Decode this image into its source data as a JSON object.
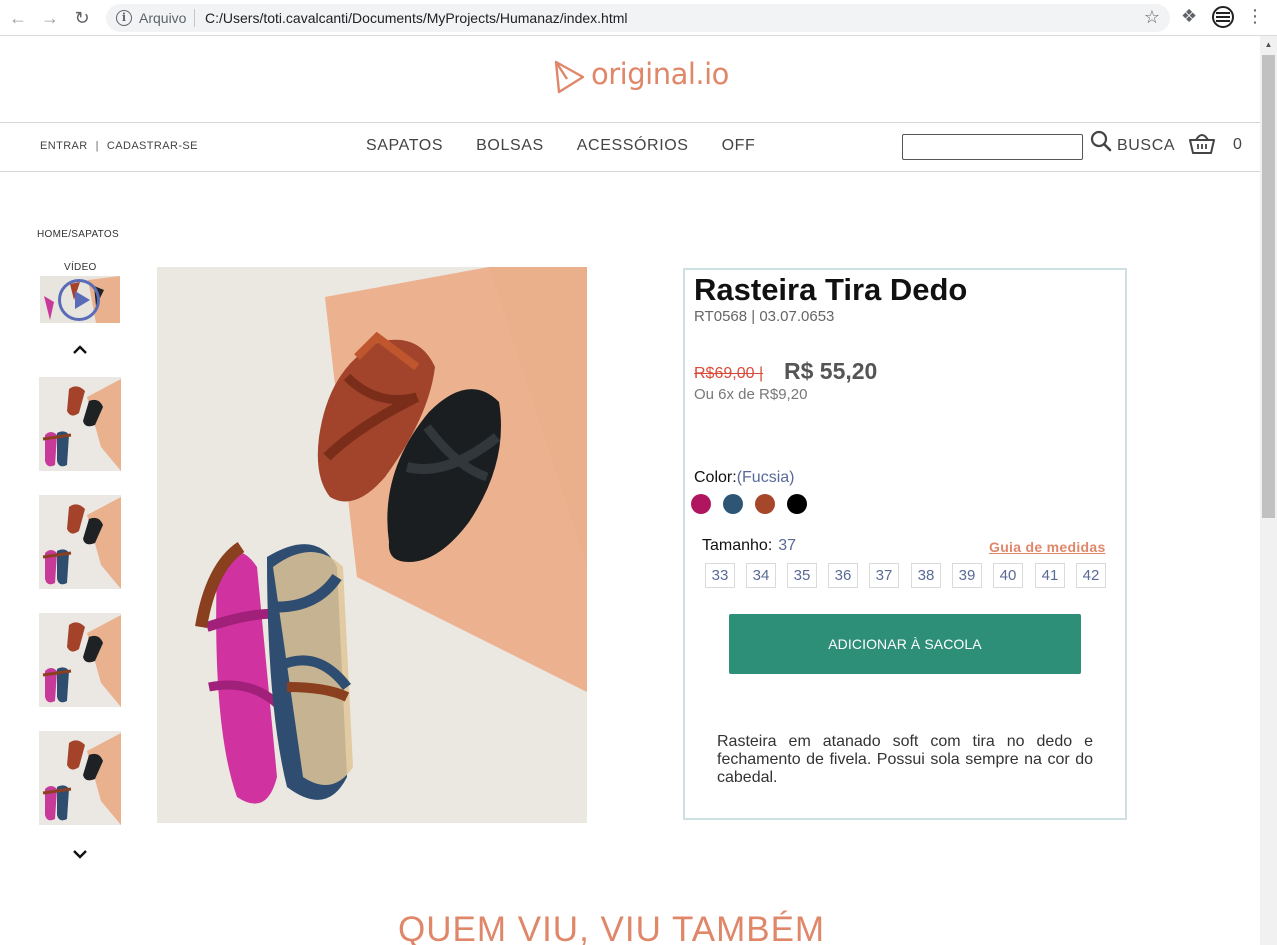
{
  "browser": {
    "back_icon": "arrow-left",
    "forward_icon": "arrow-right",
    "reload_icon": "reload",
    "omnibox_label": "Arquivo",
    "url": "C:/Users/toti.cavalcanti/Documents/MyProjects/Humanaz/index.html"
  },
  "header": {
    "logo_text": "original.io",
    "account": {
      "login": "ENTRAR",
      "separator": "|",
      "register": "CADASTRAR-SE"
    },
    "menu": [
      "SAPATOS",
      "BOLSAS",
      "ACESSÓRIOS",
      "OFF"
    ],
    "search": {
      "value": "",
      "label": "BUSCA"
    },
    "cart_count": "0"
  },
  "breadcrumb": "HOME/SAPATOS",
  "gallery": {
    "video_label": "VÍDEO",
    "thumb_count": 4
  },
  "product": {
    "title": "Rasteira Tira Dedo",
    "reference": "RT0568 | 03.07.0653",
    "old_price": "R$69,00 |",
    "price": "R$ 55,20",
    "installments": "Ou 6x de R$9,20",
    "color_label": "Color:",
    "color_selected": "(Fucsia)",
    "colors": [
      "#b0155f",
      "#2f5574",
      "#a6472a",
      "#000000"
    ],
    "size_label": "Tamanho:",
    "size_selected": "37",
    "size_guide": "Guia de medidas",
    "sizes": [
      "33",
      "34",
      "35",
      "36",
      "37",
      "38",
      "39",
      "40",
      "41",
      "42"
    ],
    "add_button": "ADICIONAR À SACOLA",
    "description": "Rasteira em atanado soft com tira no dedo e fechamento de fivela. Possui sola sempre na cor do cabedal."
  },
  "related_title": "QUEM VIU, VIU TAMBÉM",
  "colors": {
    "accent": "#e0876a",
    "button": "#2e8f79",
    "card_border": "#cfe0e2"
  }
}
